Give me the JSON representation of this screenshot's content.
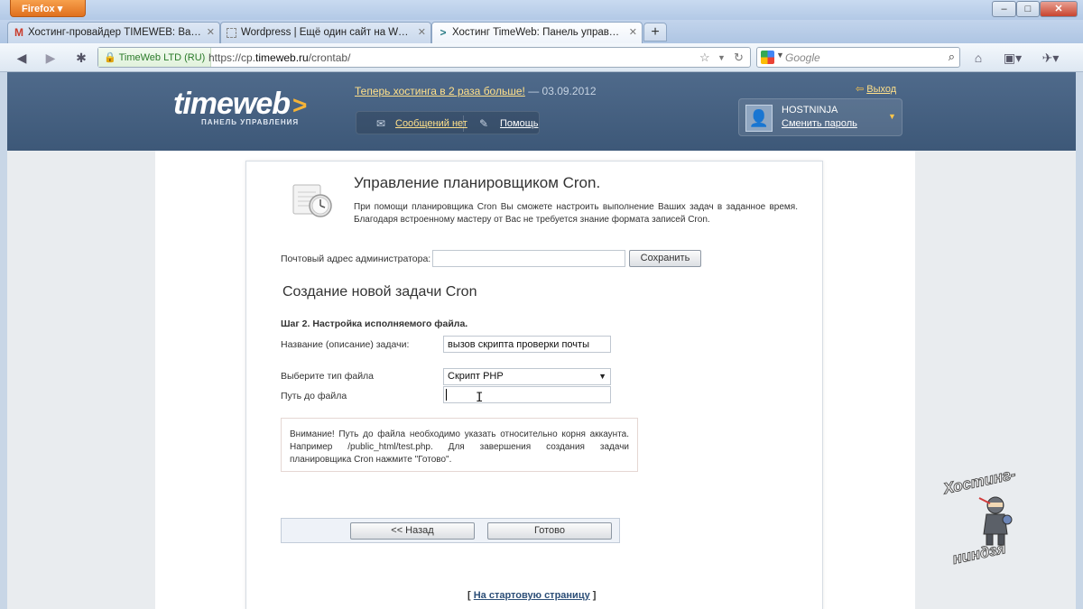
{
  "browser": {
    "menu_button": "Firefox",
    "window_controls": {
      "minimize": "–",
      "maximize": "□",
      "close": "✕"
    },
    "tabs": [
      {
        "title": "Хостинг-провайдер TIMEWEB: Ваш ...",
        "icon": "gmail-icon"
      },
      {
        "title": "Wordpress | Ещё один сайт на Word...",
        "icon": "page-icon"
      },
      {
        "title": "Хостинг TimeWeb: Панель управле...",
        "icon": "timeweb-icon"
      }
    ],
    "new_tab": "+",
    "identity": "TimeWeb  LTD (RU)",
    "url_prefix": "https://cp.",
    "url_domain": "timeweb.ru",
    "url_path": "/crontab/",
    "search_placeholder": "Google"
  },
  "header": {
    "logo": "timeweb",
    "logo_arrow": ">",
    "logo_subtitle": "ПАНЕЛЬ УПРАВЛЕНИЯ",
    "news_link": "Теперь хостинга в 2 раза больше!",
    "news_date": " — 03.09.2012",
    "messages": "Сообщений нет",
    "help": "Помощь",
    "logout": "Выход",
    "username": "HOSTNINJA",
    "change_password": "Сменить пароль"
  },
  "main": {
    "title": "Управление планировщиком Cron.",
    "description": "При помощи планировщика Cron Вы сможете настроить выполнение Ваших задач в заданное время. Благодаря встроенному мастеру от Вас не требуется знание формата записей Cron.",
    "admin_email_label": "Почтовый адрес администратора:",
    "admin_email_value": "",
    "save_button": "Сохранить",
    "section_title": "Создание новой задачи Cron",
    "step_title": "Шаг 2. Настройка исполняемого файла.",
    "task_name_label": "Название (описание) задачи:",
    "task_name_value": "вызов скрипта проверки почты",
    "file_type_label": "Выберите тип файла",
    "file_type_value": "Скрипт PHP",
    "file_path_label": "Путь до файла",
    "file_path_value": "",
    "notice": "Внимание! Путь до файла необходимо указать относительно корня аккаунта. Например /public_html/test.php. Для завершения создания задачи планировщика Cron нажмите \"Готово\".",
    "back_button": "<< Назад",
    "done_button": "Готово",
    "home_open": "[ ",
    "home_link": "На стартовую страницу",
    "home_close": " ]"
  },
  "watermark": {
    "top": "Хостинг-",
    "bottom": "ниндзя"
  },
  "colors": {
    "header": "#45607f",
    "link_yellow": "#ffe08a",
    "accent_orange": "#f6b437"
  }
}
